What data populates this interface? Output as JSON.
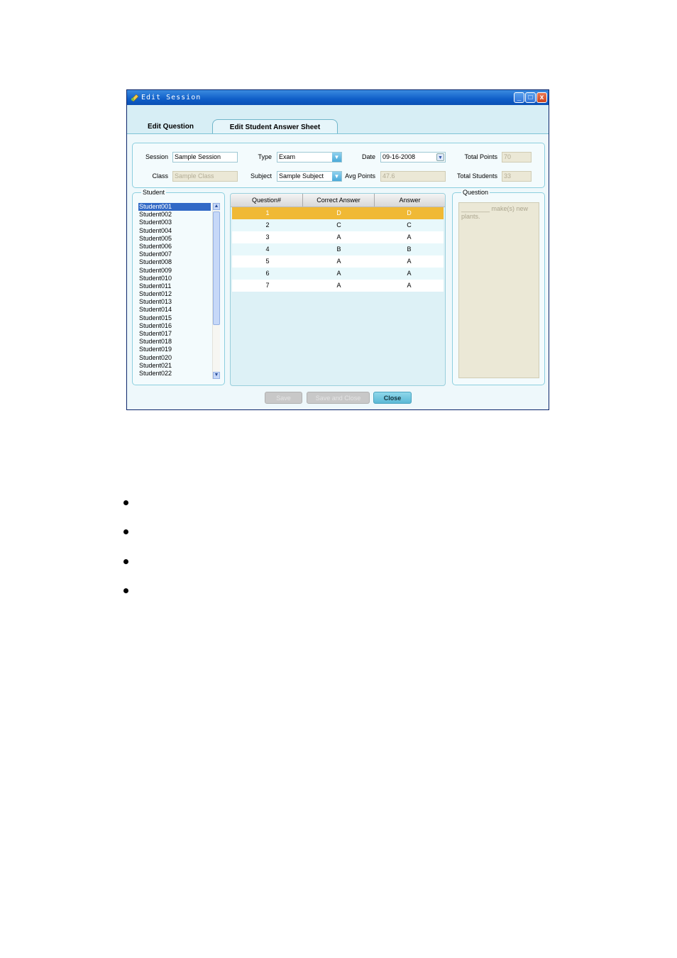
{
  "window": {
    "title": "Edit Session",
    "controls": {
      "minimize": "_",
      "maximize": "□",
      "close": "x"
    }
  },
  "tabs": [
    {
      "label": "Edit Question",
      "active": false
    },
    {
      "label": "Edit Student Answer Sheet",
      "active": true
    }
  ],
  "form": {
    "session_label": "Session",
    "session_value": "Sample Session",
    "type_label": "Type",
    "type_value": "Exam",
    "date_label": "Date",
    "date_value": "09-16-2008",
    "total_points_label": "Total Points",
    "total_points_value": "70",
    "class_label": "Class",
    "class_value": "Sample Class",
    "subject_label": "Subject",
    "subject_value": "Sample Subject",
    "avg_points_label": "Avg Points",
    "avg_points_value": "47.6",
    "total_students_label": "Total Students",
    "total_students_value": "33"
  },
  "student_panel": {
    "title": "Student",
    "students": [
      "Student001",
      "Student002",
      "Student003",
      "Student004",
      "Student005",
      "Student006",
      "Student007",
      "Student008",
      "Student009",
      "Student010",
      "Student011",
      "Student012",
      "Student013",
      "Student014",
      "Student015",
      "Student016",
      "Student017",
      "Student018",
      "Student019",
      "Student020",
      "Student021",
      "Student022"
    ],
    "selected_index": 0
  },
  "answers": {
    "columns": [
      "Question#",
      "Correct Answer",
      "Answer"
    ],
    "rows": [
      [
        "1",
        "D",
        "D"
      ],
      [
        "2",
        "C",
        "C"
      ],
      [
        "3",
        "A",
        "A"
      ],
      [
        "4",
        "B",
        "B"
      ],
      [
        "5",
        "A",
        "A"
      ],
      [
        "6",
        "A",
        "A"
      ],
      [
        "7",
        "A",
        "A"
      ]
    ],
    "selected_row": 0
  },
  "question_panel": {
    "title": "Question",
    "text": "________ make(s) new plants."
  },
  "buttons": {
    "save": "Save",
    "save_close": "Save and Close",
    "close": "Close"
  },
  "colors": {
    "accent": "#f0b935",
    "title_bar": "#0f5ec8",
    "panel_border": "#8ccfdf"
  }
}
